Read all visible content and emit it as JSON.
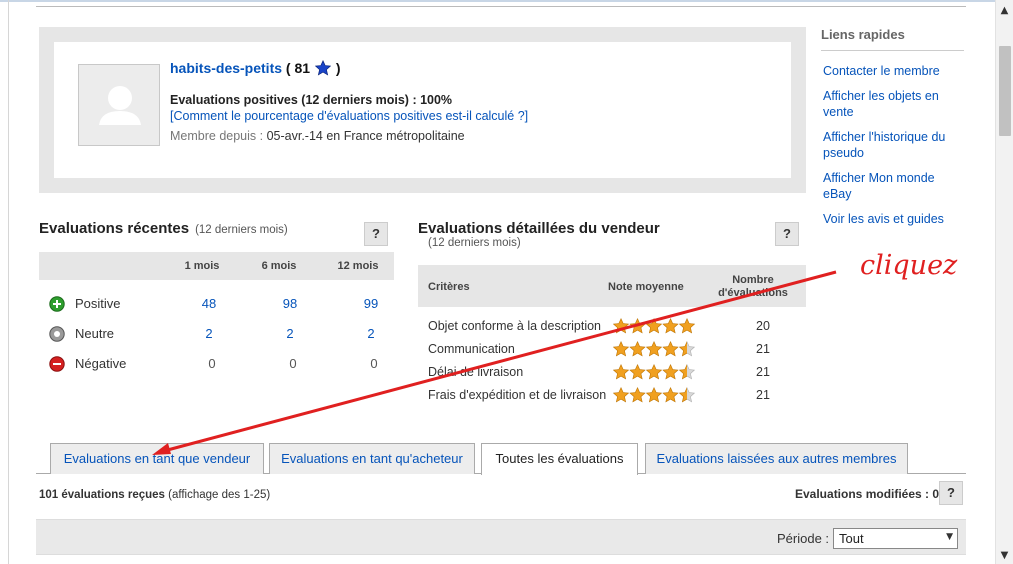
{
  "profile": {
    "seller_name": "habits-des-petits",
    "score_open": "( 81",
    "score_close": ")",
    "positive_text": "Evaluations positives (12 derniers mois) : 100%",
    "calc_link": "[Comment le pourcentage d'évaluations positives est-il calculé ?]",
    "member_label": "Membre depuis :",
    "member_value": "05-avr.-14 en France métropolitaine"
  },
  "quick_links": {
    "title": "Liens rapides",
    "items": [
      "Contacter le membre",
      "Afficher les objets en vente",
      "Afficher l'historique du pseudo",
      "Afficher Mon monde eBay",
      "Voir les avis et guides"
    ]
  },
  "recent": {
    "title": "Evaluations récentes",
    "subtitle": "(12 derniers mois)",
    "help": "?",
    "columns": [
      "1 mois",
      "6 mois",
      "12 mois"
    ],
    "rows": [
      {
        "label": "Positive",
        "values": [
          "48",
          "98",
          "99"
        ],
        "color": "#2e9e2e"
      },
      {
        "label": "Neutre",
        "values": [
          "2",
          "2",
          "2"
        ],
        "color": "#8a8a8a"
      },
      {
        "label": "Négative",
        "values": [
          "0",
          "0",
          "0"
        ],
        "color": "#d42020"
      }
    ]
  },
  "detailed": {
    "title": "Evaluations détaillées du vendeur",
    "subtitle": "(12 derniers mois)",
    "help": "?",
    "col_criteria": "Critères",
    "col_rating": "Note moyenne",
    "col_count": "Nombre d'évaluations",
    "rows": [
      {
        "criterion": "Objet conforme à la description",
        "rating": 5.0,
        "count": "20"
      },
      {
        "criterion": "Communication",
        "rating": 4.5,
        "count": "21"
      },
      {
        "criterion": "Délai de livraison",
        "rating": 4.5,
        "count": "21"
      },
      {
        "criterion": "Frais d'expédition et de livraison",
        "rating": 4.5,
        "count": "21"
      }
    ]
  },
  "tabs": [
    {
      "label": "Evaluations en tant que vendeur",
      "active": false
    },
    {
      "label": "Evaluations en tant qu'acheteur",
      "active": false
    },
    {
      "label": "Toutes les évaluations",
      "active": true
    },
    {
      "label": "Evaluations laissées aux autres membres",
      "active": false
    }
  ],
  "footer": {
    "received_bold": "101 évaluations reçues",
    "received_rest": "(affichage des 1-25)",
    "modified": "Evaluations modifiées : 0",
    "modified_help": "?",
    "period_label": "Période :",
    "period_value": "Tout"
  },
  "annotation": {
    "text": "cliquez",
    "color": "#e02020"
  },
  "colors": {
    "link": "#0654ba",
    "star": "#f0a020",
    "panel": "#e6e6e6"
  }
}
